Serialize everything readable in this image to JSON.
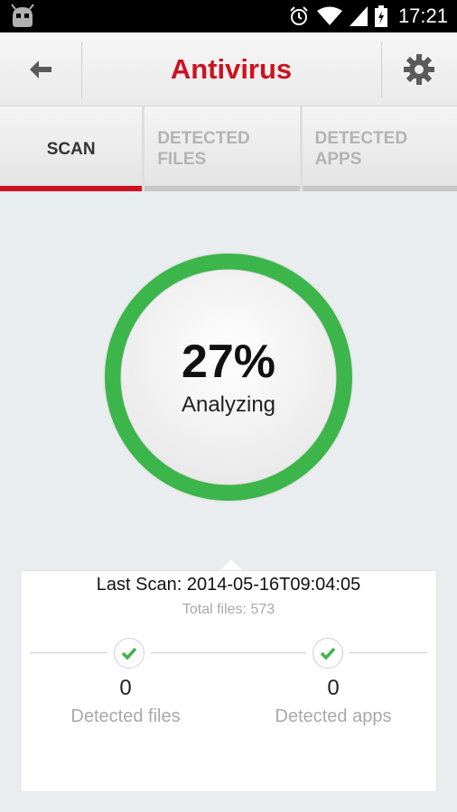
{
  "status_bar": {
    "time": "17:21",
    "icons": [
      "android-icon",
      "alarm-icon",
      "wifi-icon",
      "signal-icon",
      "battery-icon"
    ]
  },
  "action_bar": {
    "title": "Antivirus",
    "back_icon": "back-arrow-icon",
    "settings_icon": "gear-icon",
    "title_color": "#cc1222"
  },
  "tabs": [
    {
      "label": "SCAN",
      "active": true
    },
    {
      "label": "DETECTED\nFILES",
      "active": false
    },
    {
      "label": "DETECTED\nAPPS",
      "active": false
    }
  ],
  "scan": {
    "percent_text": "27%",
    "progress": 0.27,
    "status": "Analyzing",
    "ring_color": "#3cb54a"
  },
  "summary": {
    "last_scan": "Last Scan: 2014-05-16T09:04:05",
    "total_files": "Total files: 573",
    "detected_files_count": "0",
    "detected_files_label": "Detected files",
    "detected_apps_count": "0",
    "detected_apps_label": "Detected apps",
    "check_color": "#3cb54a"
  }
}
